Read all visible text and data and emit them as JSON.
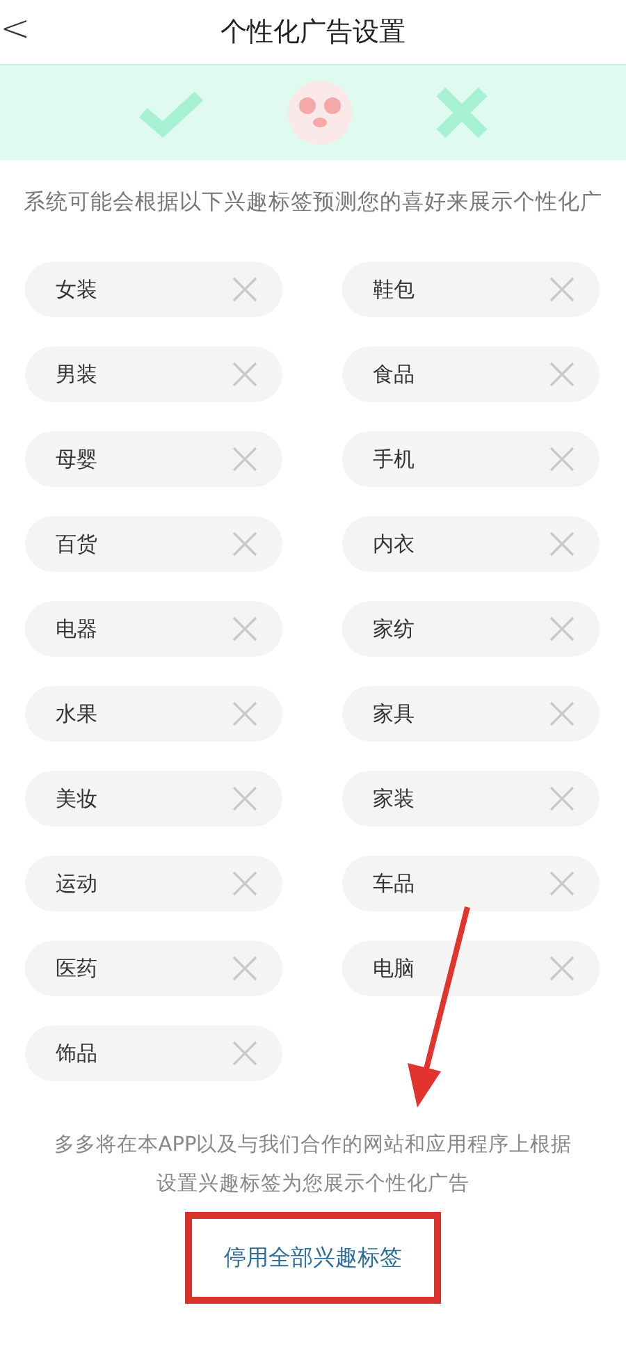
{
  "header": {
    "back": "<",
    "title": "个性化广告设置"
  },
  "intro": "系统可能会根据以下兴趣标签预测您的喜好来展示个性化广",
  "tags": [
    {
      "label": "女装"
    },
    {
      "label": "鞋包"
    },
    {
      "label": "男装"
    },
    {
      "label": "食品"
    },
    {
      "label": "母婴"
    },
    {
      "label": "手机"
    },
    {
      "label": "百货"
    },
    {
      "label": "内衣"
    },
    {
      "label": "电器"
    },
    {
      "label": "家纺"
    },
    {
      "label": "水果"
    },
    {
      "label": "家具"
    },
    {
      "label": "美妆"
    },
    {
      "label": "家装"
    },
    {
      "label": "运动"
    },
    {
      "label": "车品"
    },
    {
      "label": "医药"
    },
    {
      "label": "电脑"
    },
    {
      "label": "饰品"
    }
  ],
  "footer": [
    "多多将在本APP以及与我们合作的网站和应用程序上根据",
    "设置兴趣标签为您展示个性化广告"
  ],
  "disable_button": "停用全部兴趣标签"
}
